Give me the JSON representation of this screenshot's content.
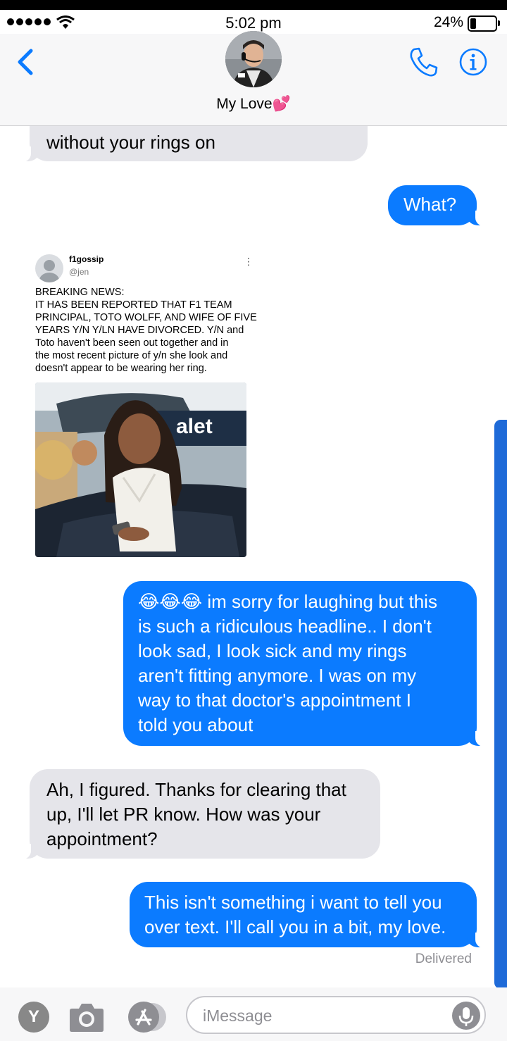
{
  "status": {
    "time": "5:02 pm",
    "battery": "24%",
    "battery_level": 0.24
  },
  "nav": {
    "contact": "My Love💕"
  },
  "messages": {
    "m0": "without your rings on",
    "m1": "What?",
    "m3": "😂😂😂 im sorry for laughing but this\nis such a ridiculous headline.. I don't\nlook sad, I look sick and my rings\naren't fitting anymore. I was on my\nway to that doctor's appointment I\ntold you about",
    "m4": "Ah, I figured. Thanks for clearing that\nup, I'll let PR know. How was your\nappointment?",
    "m5": "This isn't something i want to tell you\nover text. I'll call you in a bit, my love."
  },
  "tweet": {
    "name": "f1gossip",
    "handle": "@jen",
    "text": "BREAKING NEWS:\nIT HAS BEEN REPORTED THAT F1 TEAM\nPRINCIPAL, TOTO WOLFF, AND WIFE OF FIVE\nYEARS Y/N Y/LN HAVE DIVORCED. Y/N and\nToto haven't been seen out together and in\nthe most recent picture of y/n she look and\ndoesn't appear to be wearing her ring.",
    "photo_sign": "alet"
  },
  "delivered": "Delivered",
  "input": {
    "placeholder": "iMessage"
  },
  "apps": {
    "app_letter": "Y"
  },
  "icons": {
    "back": "chevron-left-icon",
    "phone": "phone-icon",
    "info": "info-icon",
    "camera": "camera-icon",
    "appstore": "app-store-icon",
    "mic": "microphone-icon"
  },
  "colors": {
    "accent": "#0b7bff",
    "incoming": "#e5e5ea",
    "scroll": "#1e6ad8"
  }
}
